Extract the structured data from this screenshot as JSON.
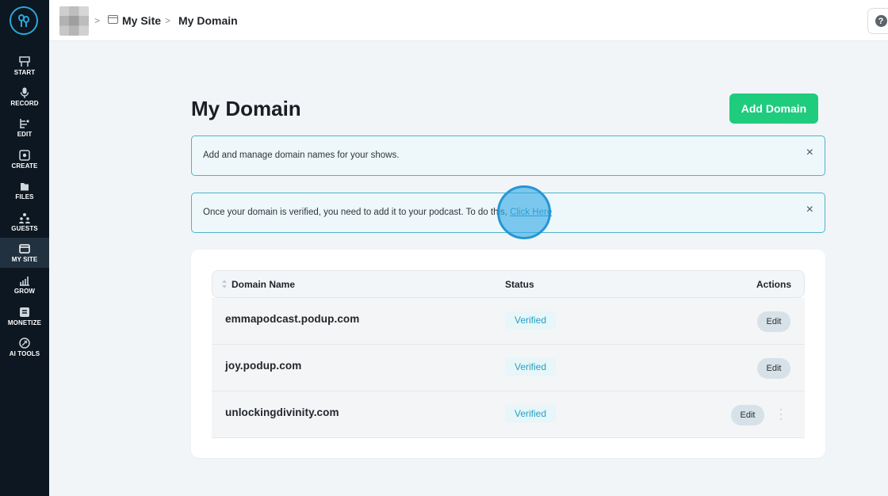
{
  "sidebar": {
    "items": [
      {
        "label": "START",
        "icon": "start-icon"
      },
      {
        "label": "RECORD",
        "icon": "microphone-icon"
      },
      {
        "label": "EDIT",
        "icon": "edit-icon"
      },
      {
        "label": "CREATE",
        "icon": "create-icon"
      },
      {
        "label": "FILES",
        "icon": "files-icon"
      },
      {
        "label": "GUESTS",
        "icon": "guests-icon"
      },
      {
        "label": "MY SITE",
        "icon": "my-site-icon",
        "active": true
      },
      {
        "label": "GROW",
        "icon": "grow-icon"
      },
      {
        "label": "MONETIZE",
        "icon": "monetize-icon"
      },
      {
        "label": "AI TOOLS",
        "icon": "ai-tools-icon"
      }
    ]
  },
  "breadcrumb": {
    "items": [
      "My Site",
      "My Domain"
    ],
    "separator": ">"
  },
  "help": {
    "label": "?"
  },
  "main": {
    "title": "My Domain",
    "add_button_label": "Add Domain",
    "alerts": [
      {
        "text": "Add and manage domain names for your shows.",
        "close": "×"
      },
      {
        "text": "Once your domain is verified, you need to add it to your podcast. To do this, ",
        "link": "Click Here",
        "close": "×"
      }
    ]
  },
  "table": {
    "columns": [
      "Domain Name",
      "Status",
      "Actions"
    ],
    "rows": [
      {
        "domain": "emmapodcast.podup.com",
        "status": "Verified",
        "action": "Edit"
      },
      {
        "domain": "joy.podup.com",
        "status": "Verified",
        "action": "Edit"
      },
      {
        "domain": "unlockingdivinity.com",
        "status": "Verified",
        "action": "Edit"
      }
    ]
  },
  "colors": {
    "sidebar_bg": "#0d1721",
    "accent_green": "#1fcb7d",
    "alert_border": "#4fb4c9",
    "link_blue": "#1e93c7",
    "verified_text": "#2a9fc2"
  }
}
